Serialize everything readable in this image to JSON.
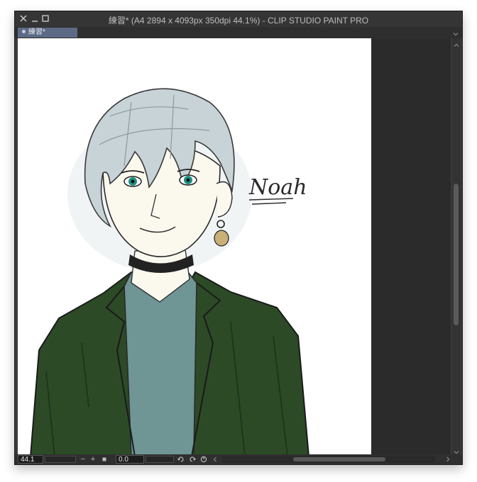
{
  "window": {
    "title": "練習* (A4 2894 x 4093px 350dpi 44.1%)  - CLIP STUDIO PAINT PRO",
    "close_icon": "close-icon",
    "minimize_icon": "minimize-icon",
    "maximize_icon": "maximize-icon"
  },
  "tabs": [
    {
      "label": "練習*",
      "active": true
    }
  ],
  "artwork": {
    "signature_text": "Noah",
    "colors": {
      "jacket": "#2d4a27",
      "shirt": "#6f9595",
      "hair": "#c7d3d6",
      "skin": "#fbf8ee",
      "eyes": "#1d8f80",
      "choker": "#222222",
      "line": "#2a2a2a"
    }
  },
  "statusbar": {
    "zoom_value": "44.1",
    "rotation_value": "0.0",
    "zoom_out_symbol": "−",
    "zoom_in_symbol": "+"
  },
  "theme": {
    "window_bg": "#3a3a3a",
    "tab_active": "#5c6a85"
  }
}
